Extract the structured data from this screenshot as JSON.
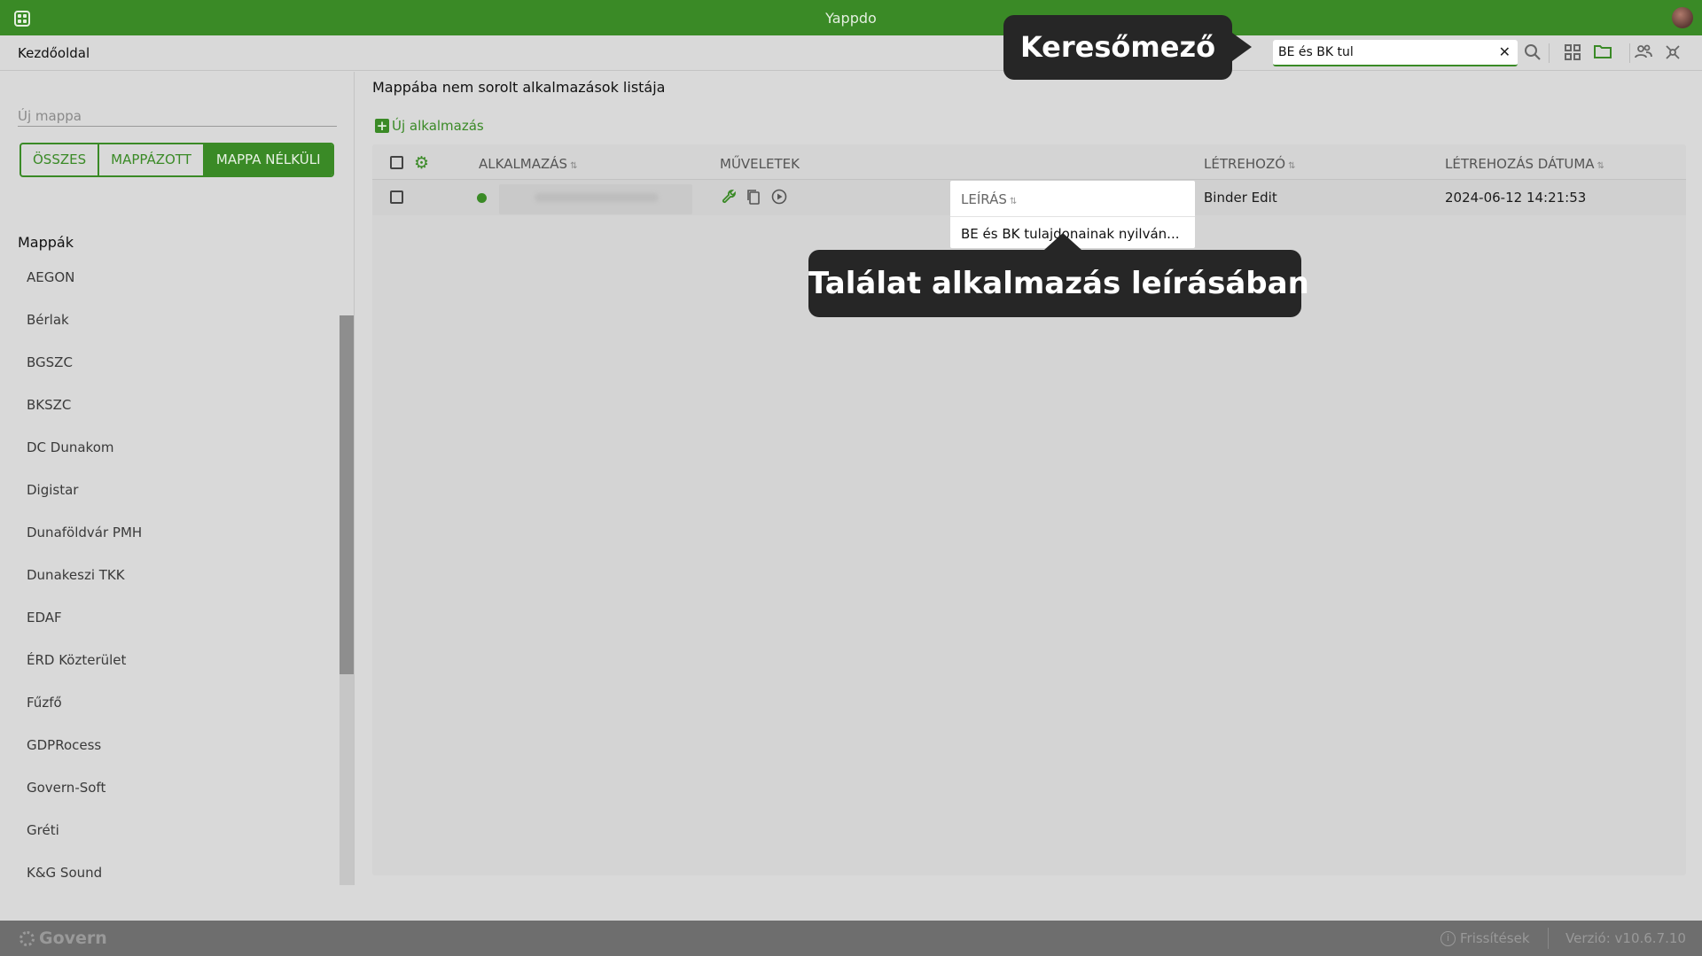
{
  "window": {
    "title": "Yappdo"
  },
  "topbar": {
    "home": "Kezdőoldal",
    "search": {
      "value": "BE és BK tul",
      "clear": "✕"
    }
  },
  "sidebar": {
    "new_folder_placeholder": "Új mappa",
    "segments": [
      "ÖSSZES",
      "MAPPÁZOTT",
      "MAPPA NÉLKÜLI"
    ],
    "active_segment": "MAPPA NÉLKÜLI",
    "folders_title": "Mappák",
    "folders": [
      "AEGON",
      "Bérlak",
      "BGSZC",
      "BKSZC",
      "DC Dunakom",
      "Digistar",
      "Dunaföldvár PMH",
      "Dunakeszi TKK",
      "EDAF",
      "ÉRD Közterület",
      "Fűzfő",
      "GDPRocess",
      "Govern-Soft",
      "Gréti",
      "K&G Sound"
    ]
  },
  "main": {
    "heading": "Mappába nem sorolt alkalmazások listája",
    "new_app": "Új alkalmazás",
    "columns": {
      "app": "ALKALMAZÁS",
      "actions": "MŰVELETEK",
      "description": "LEÍRÁS",
      "creator": "LÉTREHOZÓ",
      "created": "LÉTREHOZÁS DÁTUMA"
    },
    "rows": [
      {
        "status": "active",
        "description": "BE és BK tulajdonainak nyilván...",
        "creator": "Binder Edit",
        "created": "2024-06-12 14:21:53"
      }
    ]
  },
  "tooltips": {
    "search": "Keresőmező",
    "result": "Találat alkalmazás leírásában"
  },
  "footer": {
    "brand": "Govern",
    "updates": "Frissítések",
    "version": "Verzió: v10.6.7.10"
  },
  "colors": {
    "accent": "#3a8a26",
    "tooltip_bg": "#262626"
  }
}
